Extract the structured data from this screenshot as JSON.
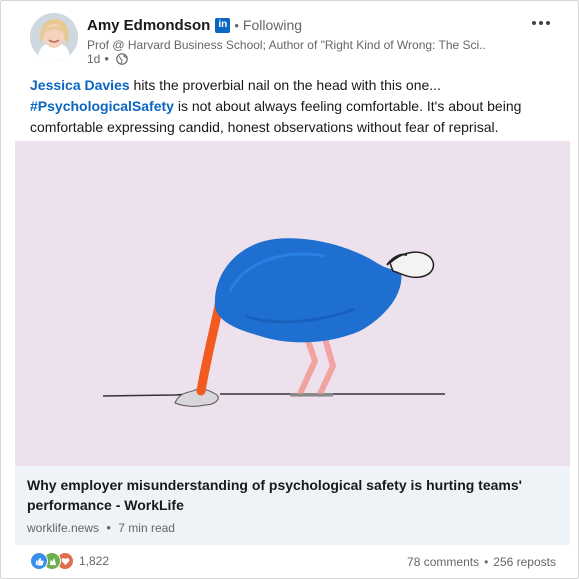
{
  "post": {
    "author": {
      "name": "Amy Edmondson",
      "badge": "in",
      "follow_status": "Following",
      "headline": "Prof @ Harvard Business School; Author of \"Right Kind of Wrong: The Sci...",
      "time": "1d",
      "visibility_icon": "globe-icon"
    },
    "more_icon": "ellipsis-icon",
    "body": {
      "mention": "Jessica Davies",
      "line1_rest": " hits the proverbial nail on the head with this one...",
      "hashtag": "#PsychologicalSafety",
      "line2_rest": " is not about always feeling comfortable. It's about being comfortable expressing candid, honest observations without fear of reprisal."
    },
    "article": {
      "title": "Why employer misunderstanding of psychological safety is hurting teams' performance - WorkLife",
      "source": "worklife.news",
      "read_time": "7 min read"
    },
    "social": {
      "reaction_icons": [
        "like-icon",
        "celebrate-icon",
        "love-icon"
      ],
      "reaction_count": "1,822",
      "comments": "78 comments",
      "reposts": "256 reposts"
    }
  },
  "colors": {
    "link_blue": "#0a66c2",
    "image_background": "#ece1ec",
    "card_background": "#eef3f8",
    "bird_blue": "#1f6fd1",
    "legs_pink": "#f2a2a0",
    "neck_orange": "#f25a22"
  }
}
